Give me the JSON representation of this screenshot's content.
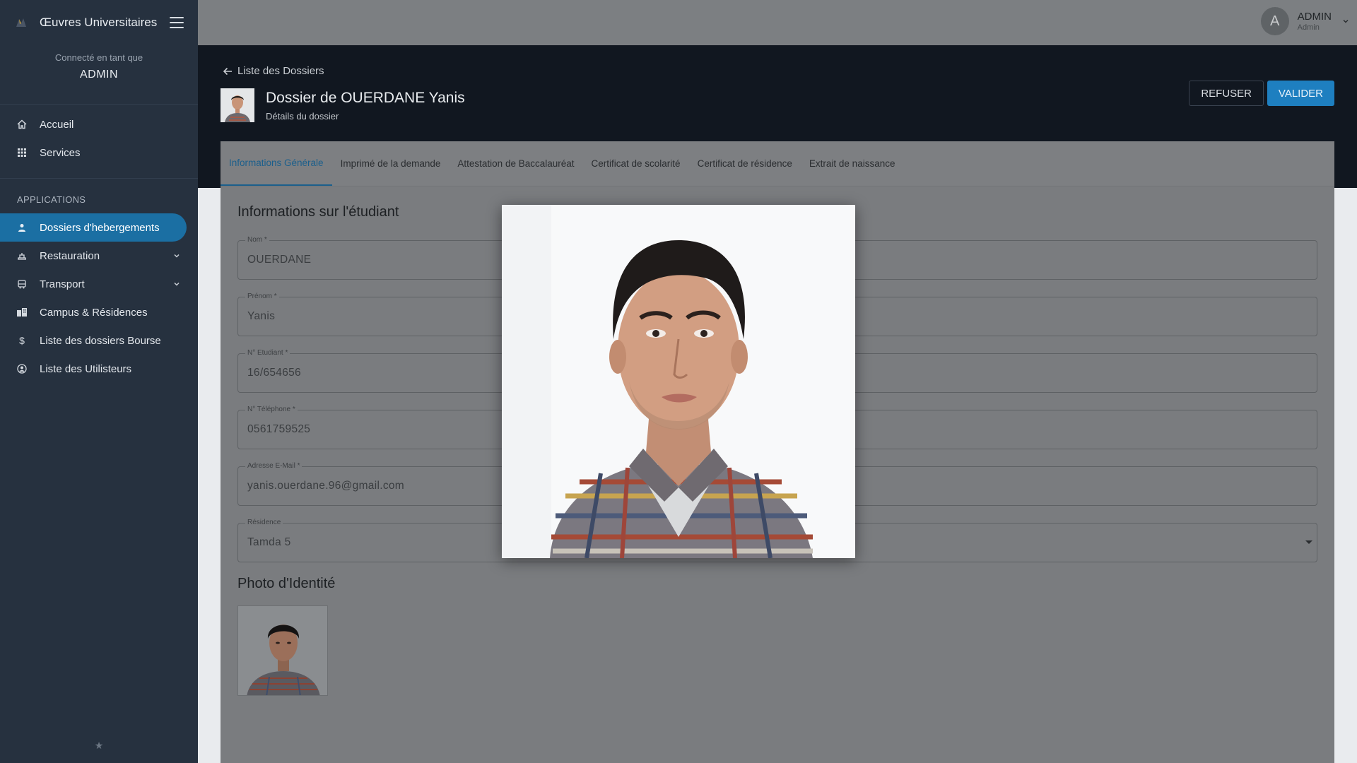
{
  "app": {
    "title": "Œuvres Universitaires",
    "connected_label": "Connecté en tant que",
    "connected_user": "ADMIN",
    "footer_symbol": "★"
  },
  "sidebar": {
    "main_items": [
      {
        "label": "Accueil",
        "icon": "home-icon"
      },
      {
        "label": "Services",
        "icon": "grid-icon"
      }
    ],
    "section_label": "APPLICATIONS",
    "app_items": [
      {
        "label": "Dossiers d'hebergements",
        "icon": "person-icon",
        "active": true
      },
      {
        "label": "Restauration",
        "icon": "restaurant-icon",
        "expandable": true
      },
      {
        "label": "Transport",
        "icon": "bus-icon",
        "expandable": true
      },
      {
        "label": "Campus & Résidences",
        "icon": "building-icon"
      },
      {
        "label": "Liste des dossiers Bourse",
        "icon": "dollar-icon"
      },
      {
        "label": "Liste des Utilisteurs",
        "icon": "users-icon"
      }
    ]
  },
  "topbar": {
    "avatar_letter": "A",
    "user_name": "ADMIN",
    "user_role": "Admin"
  },
  "header": {
    "back_label": "Liste des Dossiers",
    "title": "Dossier de OUERDANE Yanis",
    "subtitle": "Détails du dossier",
    "refuse_label": "REFUSER",
    "validate_label": "VALIDER"
  },
  "tabs": [
    {
      "label": "Informations Générale",
      "active": true
    },
    {
      "label": "Imprimé de la demande"
    },
    {
      "label": "Attestation de Baccalauréat"
    },
    {
      "label": "Certificat de scolarité"
    },
    {
      "label": "Certificat de résidence"
    },
    {
      "label": "Extrait de naissance"
    }
  ],
  "student": {
    "section_title": "Informations sur l'étudiant",
    "fields": [
      {
        "label": "Nom *",
        "value": "OUERDANE"
      },
      {
        "label": "Prénom *",
        "value": "Yanis"
      },
      {
        "label": "N° Etudiant *",
        "value": "16/654656"
      },
      {
        "label": "N° Téléphone *",
        "value": "0561759525"
      },
      {
        "label": "Adresse E-Mail *",
        "value": "yanis.ouerdane.96@gmail.com"
      },
      {
        "label": "Résidence",
        "value": "Tamda 5",
        "select": true
      }
    ],
    "photo_section_title": "Photo d'Identité"
  },
  "colors": {
    "sidebar_bg": "#26313f",
    "active_nav": "#1b6fa3",
    "validate_btn": "#1e7fc0",
    "header_band": "#111720"
  }
}
